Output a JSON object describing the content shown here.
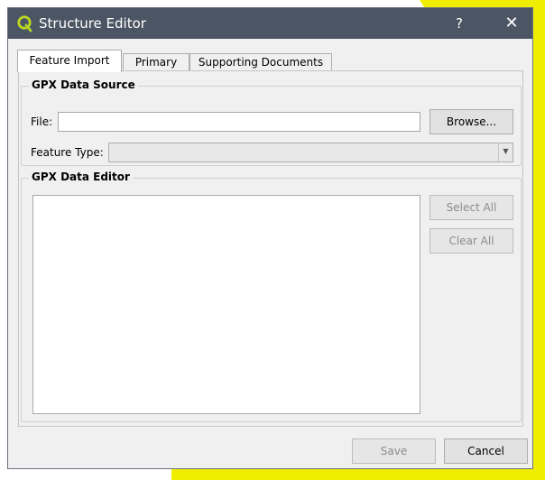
{
  "window": {
    "title": "Structure Editor",
    "help_glyph": "?",
    "close_glyph": "✕"
  },
  "tabs": [
    {
      "label": "Feature Import",
      "active": true
    },
    {
      "label": "Primary",
      "active": false
    },
    {
      "label": "Supporting Documents",
      "active": false
    }
  ],
  "source_group": {
    "title": "GPX Data Source",
    "file_label": "File:",
    "file_value": "",
    "browse_label": "Browse...",
    "feature_type_label": "Feature Type:",
    "feature_type_value": ""
  },
  "editor_group": {
    "title": "GPX Data Editor",
    "select_all_label": "Select All",
    "clear_all_label": "Clear All"
  },
  "footer": {
    "save_label": "Save",
    "cancel_label": "Cancel"
  },
  "colors": {
    "titlebar": "#4b5563",
    "accent_yellow": "#f0ee00",
    "window_bg": "#f0f0f0"
  },
  "icons": {
    "app_logo": "qgis-logo-icon",
    "combo_arrow": "chevron-down-icon"
  }
}
